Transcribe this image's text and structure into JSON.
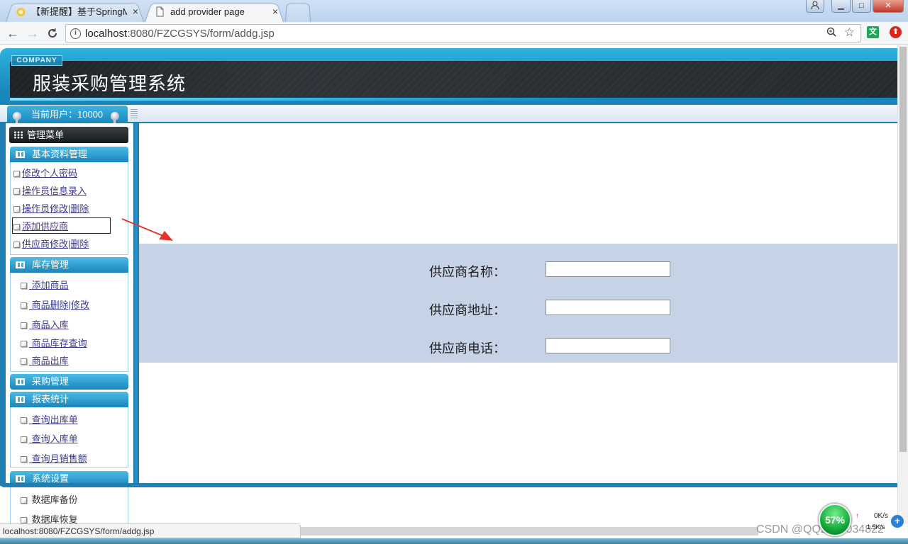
{
  "browser": {
    "tabs": [
      {
        "title": "【新提醒】基于SpringM",
        "close": "×"
      },
      {
        "title": "add provider page",
        "close": "×"
      }
    ],
    "back": "←",
    "forward": "→",
    "reload": "C",
    "url_host": "localhost",
    "url_rest": ":8080/FZCGSYS/form/addg.jsp",
    "zoom": "⊕",
    "star": "☆",
    "window_controls": {
      "minimize": "▁",
      "maximize": "□",
      "close": "✕"
    }
  },
  "header": {
    "company": "COMPANY",
    "title": "服装采购管理系统"
  },
  "userbar": {
    "current_user": "当前用户：10000"
  },
  "sidebar": {
    "menu_title": "管理菜单",
    "sections": [
      {
        "title": "基本资料管理",
        "items": [
          "修改个人密码",
          "操作员信息录入",
          "操作员修改|删除",
          "添加供应商",
          "供应商修改|删除"
        ]
      },
      {
        "title": "库存管理",
        "items": [
          "添加商品",
          "商品删除|修改",
          "商品入库",
          "商品库存查询",
          "商品出库"
        ]
      },
      {
        "title": "采购管理",
        "items": []
      },
      {
        "title": "报表统计",
        "items": [
          "查询出库单",
          "查询入库单",
          "查询月销售额"
        ]
      },
      {
        "title": "系统设置",
        "items": [
          "数据库备份",
          "数据库恢复"
        ]
      }
    ]
  },
  "form": {
    "fields": [
      {
        "label": "供应商名称：",
        "value": ""
      },
      {
        "label": "供应商地址：",
        "value": ""
      },
      {
        "label": "供应商电话：",
        "value": ""
      }
    ]
  },
  "statusbar": {
    "hover_url": "localhost:8080/FZCGSYS/form/addg.jsp",
    "watermark": "CSDN @QQ2892034822",
    "net_percent": "57%",
    "net_up": "0K/s",
    "net_down": "1.5K/s"
  },
  "colors": {
    "banner": "#1a89bd",
    "form_band": "#c6d3e7",
    "link": "#3b3a8d",
    "arrow": "#e8322c"
  }
}
